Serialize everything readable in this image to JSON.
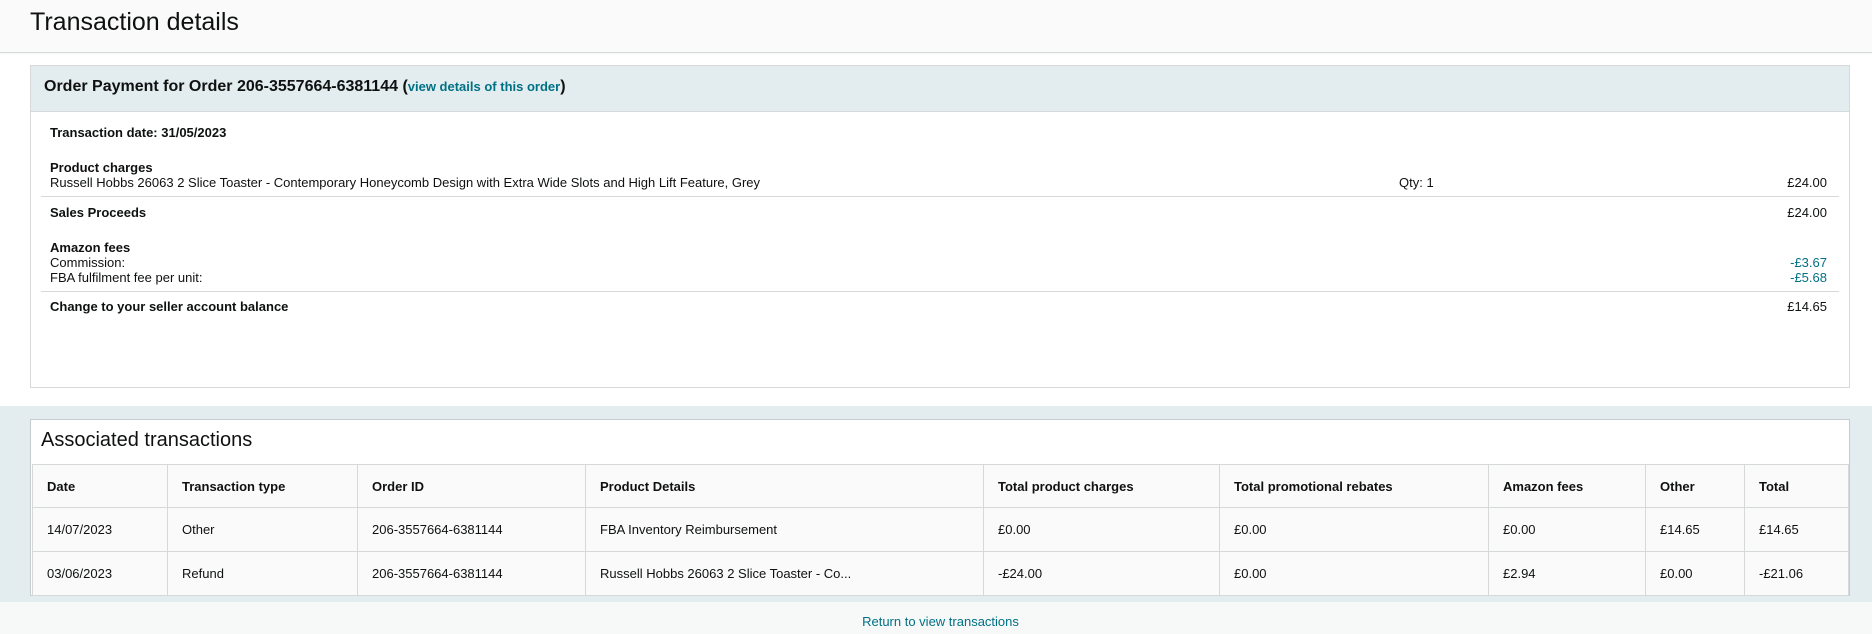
{
  "page": {
    "title": "Transaction details"
  },
  "payment": {
    "heading_prefix": "Order Payment for Order 206-3557664-6381144 (",
    "view_link": "view details of this order",
    "heading_suffix": ")",
    "transaction_date": "Transaction date: 31/05/2023",
    "product_charges": {
      "label": "Product charges",
      "product_name": "Russell Hobbs 26063 2 Slice Toaster - Contemporary Honeycomb Design with Extra Wide Slots and High Lift Feature, Grey",
      "qty": "Qty: 1",
      "amount": "£24.00"
    },
    "sales_proceeds": {
      "label": "Sales Proceeds",
      "amount": "£24.00"
    },
    "amazon_fees": {
      "label": "Amazon fees",
      "commission_label": "Commission:",
      "commission_amount": "-£3.67",
      "fba_label": "FBA fulfilment fee per unit:",
      "fba_amount": "-£5.68"
    },
    "balance_change": {
      "label": "Change to your seller account balance",
      "amount": "£14.65"
    }
  },
  "associated": {
    "title": "Associated transactions",
    "columns": [
      "Date",
      "Transaction type",
      "Order ID",
      "Product Details",
      "Total product charges",
      "Total promotional rebates",
      "Amazon fees",
      "Other",
      "Total"
    ],
    "rows": [
      {
        "date": "14/07/2023",
        "type": "Other",
        "order_id": "206-3557664-6381144",
        "product": "FBA Inventory Reimbursement",
        "product_charges": "£0.00",
        "promo_rebates": "£0.00",
        "amazon_fees": "£0.00",
        "other": "£14.65",
        "total": "£14.65"
      },
      {
        "date": "03/06/2023",
        "type": "Refund",
        "order_id": "206-3557664-6381144",
        "product": "Russell Hobbs 26063 2 Slice Toaster - Co...",
        "product_charges": "-£24.00",
        "promo_rebates": "£0.00",
        "amazon_fees": "£2.94",
        "other": "£0.00",
        "total": "-£21.06"
      }
    ]
  },
  "footer": {
    "return_link": "Return to view transactions"
  },
  "colors": {
    "link": "#007185",
    "negative": "#c7511f",
    "panel_header": "#e3ecee"
  }
}
